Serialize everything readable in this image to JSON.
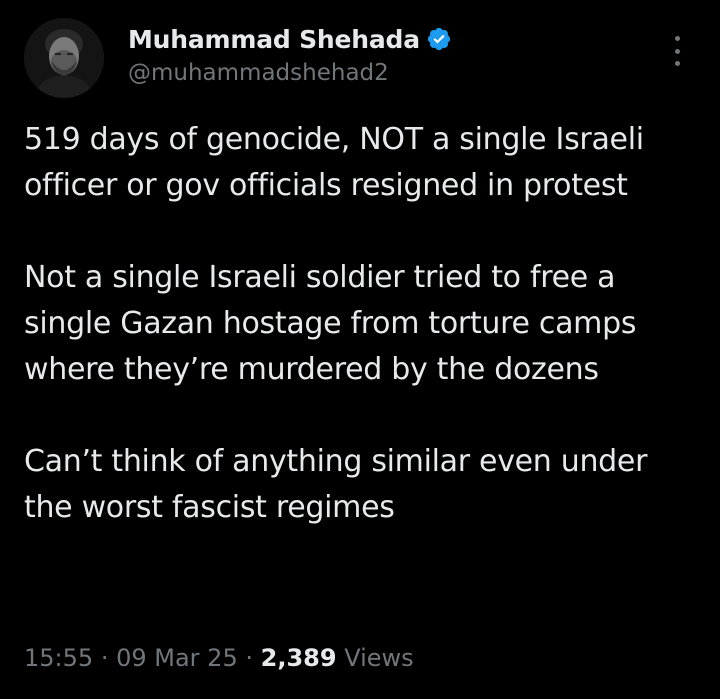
{
  "author": {
    "display_name": "Muhammad Shehada",
    "handle": "@muhammadshehad2",
    "verified_icon": "verified-badge-icon",
    "verified_color": "#1d9bf0"
  },
  "tweet": {
    "text": "519 days of genocide, NOT a single Israeli officer or gov officials resigned in protest\n\nNot a single Israeli soldier tried to free a single Gazan hostage from torture camps where they’re murdered by the dozens\n\nCan’t think of anything similar even under the worst fascist regimes"
  },
  "meta": {
    "time": "15:55",
    "separator": "·",
    "date": "09 Mar 25",
    "views_count": "2,389",
    "views_label": "Views"
  },
  "colors": {
    "background": "#000000",
    "primary_text": "#e7e9ea",
    "secondary_text": "#71767b"
  }
}
